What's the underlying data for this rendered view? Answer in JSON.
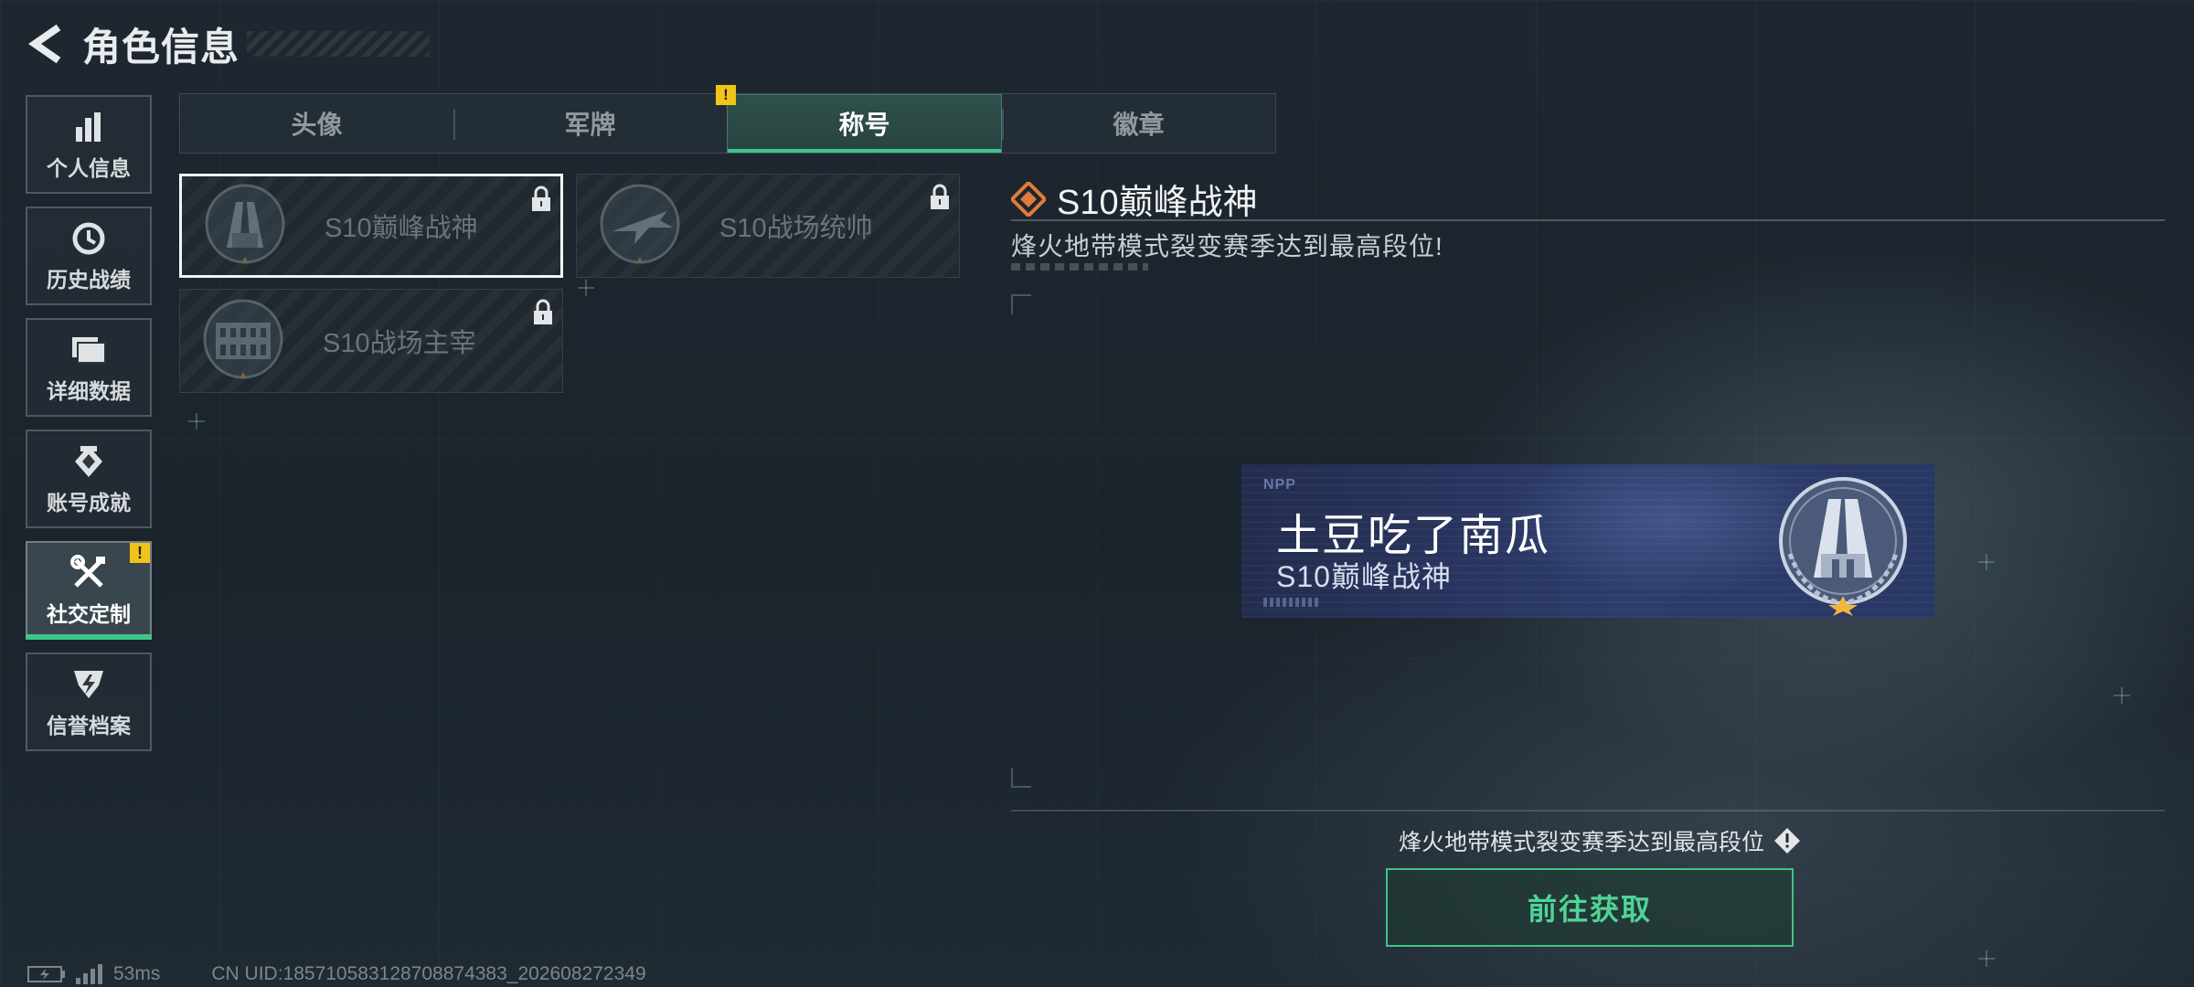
{
  "header": {
    "title": "角色信息",
    "back_icon": "back-arrow-icon"
  },
  "sidebar": {
    "items": [
      {
        "label": "个人信息",
        "icon": "bar-chart-icon",
        "active": false
      },
      {
        "label": "历史战绩",
        "icon": "clock-icon",
        "active": false
      },
      {
        "label": "详细数据",
        "icon": "folder-icon",
        "active": false
      },
      {
        "label": "账号成就",
        "icon": "achievement-icon",
        "active": false
      },
      {
        "label": "社交定制",
        "icon": "tools-icon",
        "active": true,
        "badge": "!"
      },
      {
        "label": "信誉档案",
        "icon": "reputation-shield-icon",
        "active": false
      }
    ]
  },
  "tabs": [
    {
      "label": "头像",
      "active": false
    },
    {
      "label": "军牌",
      "active": false,
      "badge": "!"
    },
    {
      "label": "称号",
      "active": true
    },
    {
      "label": "徽章",
      "active": false
    }
  ],
  "titles": [
    {
      "label": "S10巅峰战神",
      "locked": true,
      "selected": true,
      "emblem": "tower-emblem-icon"
    },
    {
      "label": "S10战场统帅",
      "locked": true,
      "selected": false,
      "emblem": "aircraft-emblem-icon"
    },
    {
      "label": "S10战场主宰",
      "locked": true,
      "selected": false,
      "emblem": "colosseum-emblem-icon"
    }
  ],
  "detail": {
    "title": "S10巅峰战神",
    "description": "烽火地带模式裂变赛季达到最高段位!",
    "banner": {
      "tag": "NPP",
      "player_name": "土豆吃了南瓜",
      "title": "S10巅峰战神"
    },
    "acquire_note": "烽火地带模式裂变赛季达到最高段位",
    "acquire_button": "前往获取"
  },
  "status_bar": {
    "ping": "53ms",
    "uid": "CN UID:18571058312870887438​3_202608272349"
  },
  "colors": {
    "accent": "#3ec58a",
    "badge": "#f0c419",
    "diamond": "#e07b3a"
  }
}
